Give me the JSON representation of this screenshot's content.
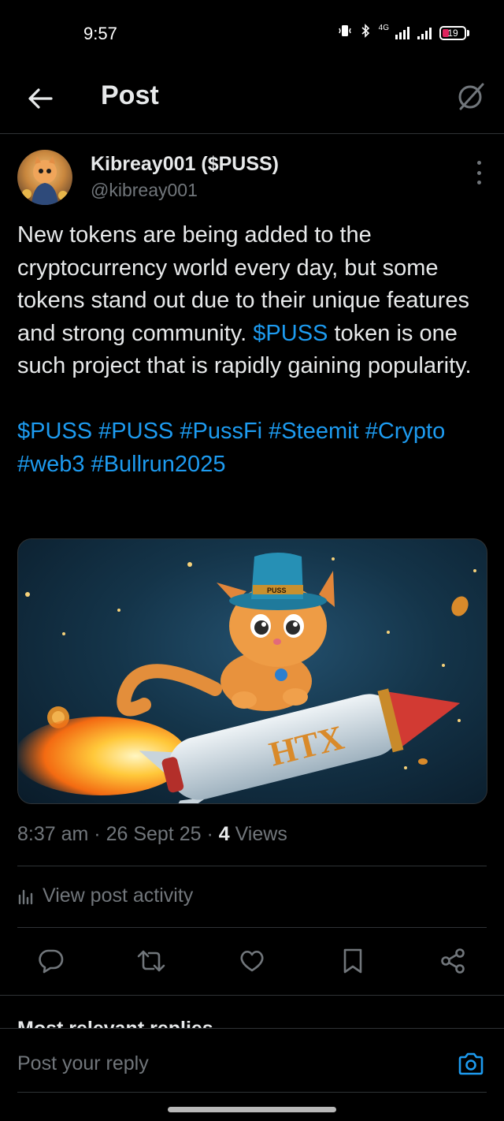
{
  "status_bar": {
    "time": "9:57",
    "network": "4G",
    "battery_level": "19",
    "icons": [
      "vibrate-icon",
      "bluetooth-icon",
      "signal-icon",
      "battery-icon"
    ]
  },
  "header": {
    "title": "Post",
    "back_icon": "arrow-left-icon",
    "grok_icon": "grok-icon"
  },
  "post": {
    "author_name": "Kibreay001 ($PUSS)",
    "author_handle": "@kibreay001",
    "text_parts": {
      "p1": "New tokens are being added to the cryptocurrency world every day, but some tokens stand out due to their unique features and strong community.",
      "cashtag": "$PUSS",
      "p1_end": " token is one such project that is rapidly gaining popularity."
    },
    "hashtags": [
      "$PUSS",
      "#PUSS",
      "#PussFi",
      "#Steemit",
      "#Crypto",
      "#web3",
      "#Bullrun2025"
    ],
    "image_text": {
      "hat_band": "PUSS",
      "rocket_label": "HTX"
    },
    "time": "8:37 am",
    "date": "26 Sept 25",
    "views_count": "4",
    "views_label": "Views",
    "activity_label": "View post activity"
  },
  "actions": [
    "reply-icon",
    "repost-icon",
    "like-icon",
    "bookmark-icon",
    "share-icon"
  ],
  "replies_header": "Most relevant replies",
  "reply_bar": {
    "placeholder": "Post your reply"
  },
  "colors": {
    "accent": "#1d9bf0",
    "text": "#e7e9ea",
    "muted": "#71767b",
    "divider": "#2f3336"
  }
}
